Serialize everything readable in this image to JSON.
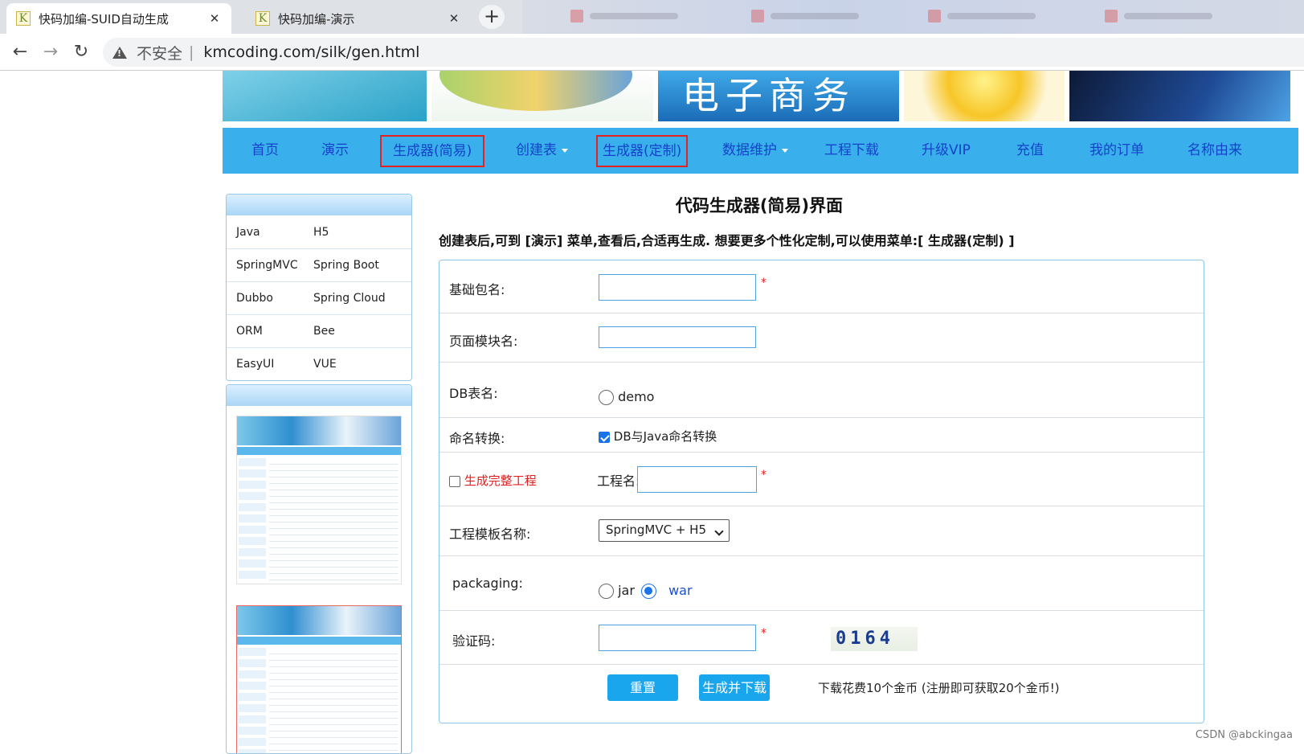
{
  "browser": {
    "tabs": [
      {
        "favicon": "K",
        "title": "快码加编-SUID自动生成"
      },
      {
        "favicon": "K",
        "title": "快码加编-演示"
      }
    ],
    "new_tab": "+",
    "insecure_label": "不安全",
    "separator": "|",
    "url": "kmcoding.com/silk/gen.html"
  },
  "banner": {
    "ecommerce_text": "电子商务"
  },
  "nav": {
    "items": [
      {
        "label": "首页"
      },
      {
        "label": "演示"
      },
      {
        "label": "生成器(简易)"
      },
      {
        "label": "创建表"
      },
      {
        "label": "生成器(定制)"
      },
      {
        "label": "数据维护"
      },
      {
        "label": "工程下载"
      },
      {
        "label": "升级VIP"
      },
      {
        "label": "充值"
      },
      {
        "label": "我的订单"
      },
      {
        "label": "名称由来"
      }
    ]
  },
  "sidebar": {
    "rows": [
      [
        "Java",
        "H5"
      ],
      [
        "SpringMVC",
        "Spring Boot"
      ],
      [
        "Dubbo",
        "Spring Cloud"
      ],
      [
        "ORM",
        "Bee"
      ],
      [
        "EasyUI",
        "VUE"
      ]
    ]
  },
  "page": {
    "title": "代码生成器(简易)界面",
    "description": "创建表后,可到 [演示] 菜单,查看后,合适再生成. 想要更多个性化定制,可以使用菜单:[  生成器(定制) ]"
  },
  "form": {
    "base_package_label": "基础包名:",
    "page_module_label": "页面模块名:",
    "db_table_label": "DB表名:",
    "db_table_option": "demo",
    "naming_label": "命名转换:",
    "naming_option": "DB与Java命名转换",
    "full_project_label": "生成完整工程",
    "project_name_label": "工程名:",
    "template_label": "工程模板名称:",
    "template_value": "SpringMVC + H5",
    "packaging_label": "packaging:",
    "packaging_options": [
      "jar",
      "war"
    ],
    "captcha_label": "验证码:",
    "captcha_text": "0164",
    "required_mark": "*",
    "reset_button": "重置",
    "generate_button": "生成并下载",
    "cost_note": "下载花费10个金币 (注册即可获取20个金币!)"
  },
  "watermark": "CSDN @abckingaa"
}
